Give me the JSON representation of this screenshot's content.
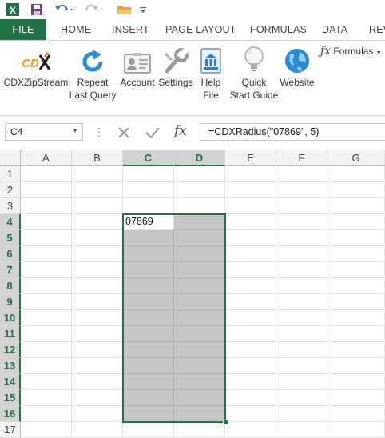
{
  "qat": {
    "icons": [
      "excel-app-icon",
      "save-icon",
      "undo-icon",
      "redo-icon",
      "open-folder-icon",
      "customize-qat-icon"
    ]
  },
  "tabs": [
    "FILE",
    "HOME",
    "INSERT",
    "PAGE LAYOUT",
    "FORMULAS",
    "DATA",
    "REV"
  ],
  "ribbon": {
    "buttons": [
      {
        "line1": "CDXZipStream",
        "line2": "",
        "icon": "cdx-logo-icon"
      },
      {
        "line1": "Repeat",
        "line2": "Last Query",
        "icon": "refresh-icon"
      },
      {
        "line1": "Account",
        "line2": "",
        "icon": "account-card-icon"
      },
      {
        "line1": "Settings",
        "line2": "",
        "icon": "wrench-icon"
      },
      {
        "line1": "Help",
        "line2": "File",
        "icon": "help-building-icon"
      },
      {
        "line1": "Quick",
        "line2": "Start Guide",
        "icon": "lightbulb-icon"
      },
      {
        "line1": "Website",
        "line2": "",
        "icon": "globe-icon"
      }
    ],
    "formulas_dropdown": "Formulas"
  },
  "formula_bar": {
    "name_box": "C4",
    "separator": "⋮",
    "formula": "=CDXRadius(\"07869\", 5)",
    "cancel_icon": "cancel-x-icon",
    "enter_icon": "enter-check-icon",
    "fx_label": "fx"
  },
  "grid": {
    "columns": [
      "A",
      "B",
      "C",
      "D",
      "E",
      "F",
      "G"
    ],
    "rows": [
      "1",
      "2",
      "3",
      "4",
      "5",
      "6",
      "7",
      "8",
      "9",
      "10",
      "11",
      "12",
      "13",
      "14",
      "15",
      "16",
      "17"
    ],
    "selected_columns": [
      "C",
      "D"
    ],
    "selected_rows": [
      "4",
      "5",
      "6",
      "7",
      "8",
      "9",
      "10",
      "11",
      "12",
      "13",
      "14",
      "15",
      "16"
    ],
    "active_cell": "C4",
    "active_cell_value": "07869",
    "accent_color": "#217346",
    "selection_fill": "#c6c6c6"
  }
}
